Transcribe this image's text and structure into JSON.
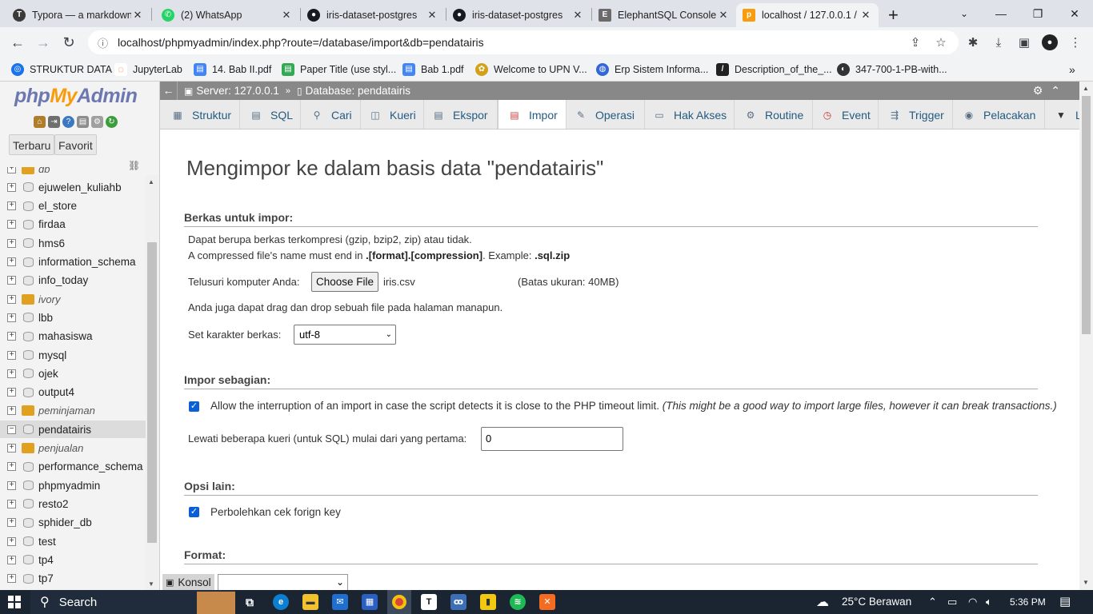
{
  "browser": {
    "tabs": [
      {
        "title": "Typora — a markdown",
        "icon": "typora-icon",
        "color": "#3a3a3a"
      },
      {
        "title": "(2) WhatsApp",
        "icon": "whatsapp-icon",
        "color": "#25d366"
      },
      {
        "title": "iris-dataset-postgres",
        "icon": "github-icon",
        "color": "#161b22"
      },
      {
        "title": "iris-dataset-postgres",
        "icon": "github-icon",
        "color": "#161b22"
      },
      {
        "title": "ElephantSQL Console",
        "icon": "elephantsql-icon",
        "color": "#6b6b6b"
      },
      {
        "title": "localhost / 127.0.0.1 /",
        "icon": "phpmyadmin-icon",
        "color": "#f89c0e"
      }
    ],
    "url": "localhost/phpmyadmin/index.php?route=/database/import&db=pendatairis",
    "bookmarks": [
      {
        "label": "STRUKTUR DATA",
        "color": "#1a73e8"
      },
      {
        "label": "JupyterLab",
        "color": "#f37726"
      },
      {
        "label": "14. Bab II.pdf",
        "color": "#4285f4"
      },
      {
        "label": "Paper Title (use styl...",
        "color": "#34a853"
      },
      {
        "label": "Bab 1.pdf",
        "color": "#4285f4"
      },
      {
        "label": "Welcome to UPN V...",
        "color": "#d4a017"
      },
      {
        "label": "Erp Sistem Informa...",
        "color": "#3367d6"
      },
      {
        "label": "Description_of_the_...",
        "color": "#222222"
      },
      {
        "label": "347-700-1-PB-with...",
        "color": "#333333"
      }
    ]
  },
  "pma": {
    "logo_a": "php",
    "logo_b": "My",
    "logo_c": "Admin",
    "nav_tabs": [
      "Terbaru",
      "Favorit"
    ],
    "databases": [
      {
        "name": "db",
        "group": true
      },
      {
        "name": "ejuwelen_kuliahb",
        "group": false
      },
      {
        "name": "el_store",
        "group": false
      },
      {
        "name": "firdaa",
        "group": false
      },
      {
        "name": "hms6",
        "group": false
      },
      {
        "name": "information_schema",
        "group": false
      },
      {
        "name": "info_today",
        "group": false
      },
      {
        "name": "ivory",
        "group": true
      },
      {
        "name": "lbb",
        "group": false
      },
      {
        "name": "mahasiswa",
        "group": false
      },
      {
        "name": "mysql",
        "group": false
      },
      {
        "name": "ojek",
        "group": false
      },
      {
        "name": "output4",
        "group": false
      },
      {
        "name": "peminjaman",
        "group": true
      },
      {
        "name": "pendatairis",
        "group": false,
        "selected": true
      },
      {
        "name": "penjualan",
        "group": true
      },
      {
        "name": "performance_schema",
        "group": false
      },
      {
        "name": "phpmyadmin",
        "group": false
      },
      {
        "name": "resto2",
        "group": false
      },
      {
        "name": "sphider_db",
        "group": false
      },
      {
        "name": "test",
        "group": false
      },
      {
        "name": "tp4",
        "group": false
      },
      {
        "name": "tp7",
        "group": false
      }
    ],
    "breadcrumb": {
      "server": "Server: 127.0.0.1",
      "database": "Database: pendatairis"
    },
    "menu": [
      {
        "label": "Struktur",
        "icon": "structure-icon"
      },
      {
        "label": "SQL",
        "icon": "sql-icon"
      },
      {
        "label": "Cari",
        "icon": "search-icon"
      },
      {
        "label": "Kueri",
        "icon": "query-icon"
      },
      {
        "label": "Ekspor",
        "icon": "export-icon"
      },
      {
        "label": "Impor",
        "icon": "import-icon",
        "active": true
      },
      {
        "label": "Operasi",
        "icon": "operations-icon"
      },
      {
        "label": "Hak Akses",
        "icon": "privileges-icon"
      },
      {
        "label": "Routine",
        "icon": "routines-icon"
      },
      {
        "label": "Event",
        "icon": "events-icon"
      },
      {
        "label": "Trigger",
        "icon": "triggers-icon"
      },
      {
        "label": "Pelacakan",
        "icon": "tracking-icon"
      },
      {
        "label": "La",
        "icon": "more-icon"
      }
    ],
    "page_title": "Mengimpor ke dalam basis data \"pendatairis\"",
    "file_section": {
      "heading": "Berkas untuk impor:",
      "line1": "Dapat berupa berkas terkompresi (gzip, bzip2, zip) atau tidak.",
      "line2_pre": "A compressed file's name must end in ",
      "line2_bold": ".[format].[compression]",
      "line2_mid": ". Example: ",
      "line2_example": ".sql.zip",
      "browse_label": "Telusuri komputer Anda:",
      "choose_button": "Choose File",
      "chosen_file": "iris.csv",
      "max_size": "(Batas ukuran: 40MB)",
      "drag_hint": "Anda juga dapat drag dan drop sebuah file pada halaman manapun.",
      "charset_label": "Set karakter berkas:",
      "charset_value": "utf-8"
    },
    "partial_section": {
      "heading": "Impor sebagian:",
      "allow_interrupt": "Allow the interruption of an import in case the script detects it is close to the PHP timeout limit.",
      "allow_interrupt_note": "(This might be a good way to import large files, however it can break transactions.)",
      "skip_label": "Lewati beberapa kueri (untuk SQL) mulai dari yang pertama:",
      "skip_value": "0"
    },
    "other_section": {
      "heading": "Opsi lain:",
      "fk_check": "Perbolehkan cek forign key"
    },
    "format_section": {
      "heading": "Format:"
    },
    "console_label": "Konsol"
  },
  "taskbar": {
    "search": "Search",
    "weather": "25°C  Berawan",
    "time": "5:36 PM"
  }
}
